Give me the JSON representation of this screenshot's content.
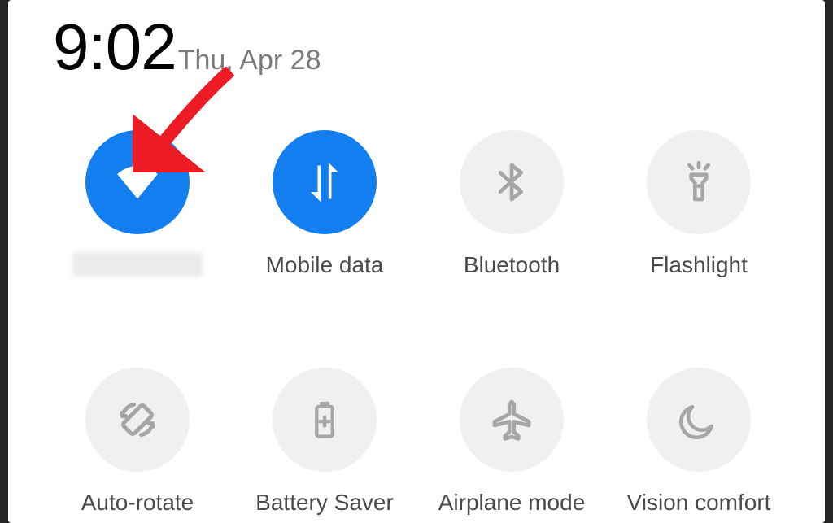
{
  "header": {
    "time": "9:02",
    "date": "Thu, Apr 28"
  },
  "tiles": {
    "wifi": {
      "label": "",
      "active": true
    },
    "mobile_data": {
      "label": "Mobile data",
      "active": true
    },
    "bluetooth": {
      "label": "Bluetooth",
      "active": false
    },
    "flashlight": {
      "label": "Flashlight",
      "active": false
    },
    "auto_rotate": {
      "label": "Auto-rotate",
      "active": false
    },
    "battery_saver": {
      "label": "Battery Saver",
      "active": false
    },
    "airplane_mode": {
      "label": "Airplane mode",
      "active": false
    },
    "vision_comfort": {
      "label": "Vision comfort",
      "active": false
    }
  },
  "colors": {
    "accent": "#137ef0",
    "off": "#f0f0f0",
    "icon_off": "#a6a6a6",
    "annotation": "#ed1c24"
  }
}
